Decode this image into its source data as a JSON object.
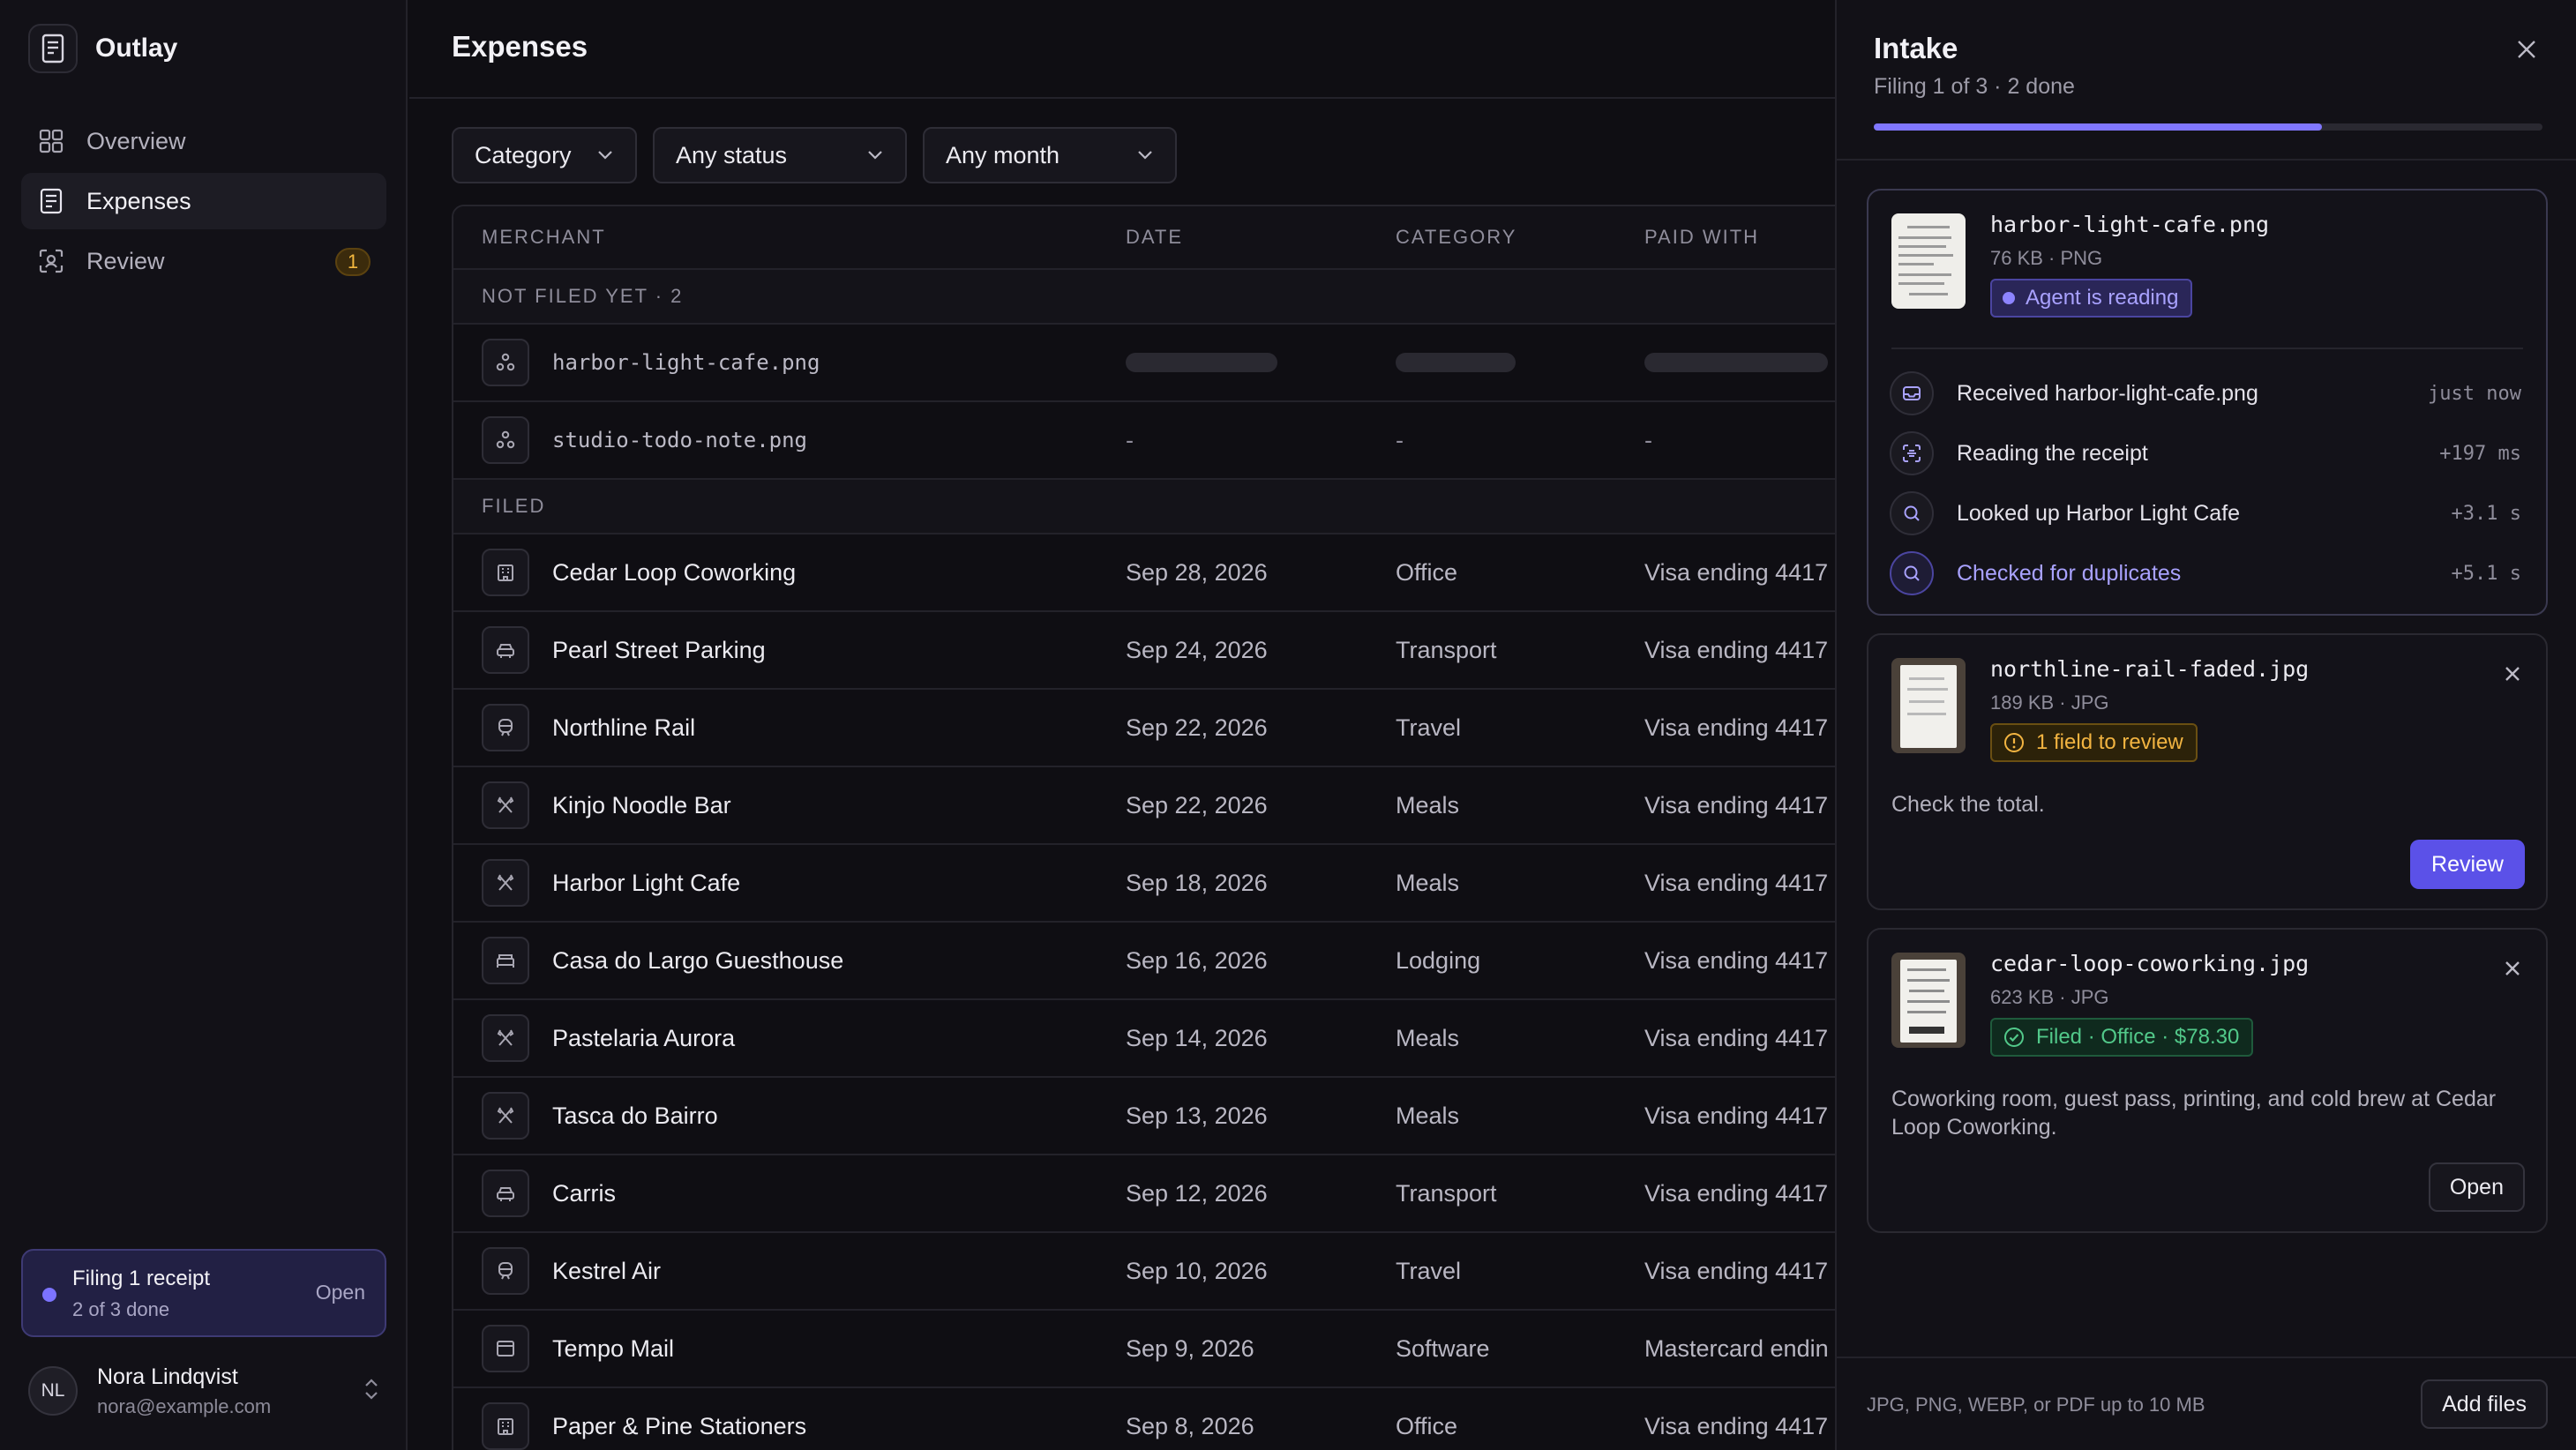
{
  "app": {
    "name": "Outlay"
  },
  "sidebar": {
    "items": [
      {
        "label": "Overview",
        "icon": "grid-icon"
      },
      {
        "label": "Expenses",
        "icon": "receipt-icon"
      },
      {
        "label": "Review",
        "icon": "scan-icon",
        "badge": "1"
      }
    ],
    "filing": {
      "title": "Filing 1 receipt",
      "subtitle": "2 of 3 done",
      "action": "Open"
    },
    "user": {
      "initials": "NL",
      "name": "Nora Lindqvist",
      "email": "nora@example.com"
    }
  },
  "main": {
    "title": "Expenses",
    "filters": {
      "category": "Category",
      "status": "Any status",
      "month": "Any month"
    },
    "columns": {
      "merchant": "MERCHANT",
      "date": "DATE",
      "category": "CATEGORY",
      "paid_with": "PAID WITH"
    },
    "groups": {
      "not_filed": "NOT FILED YET · 2",
      "filed": "FILED"
    },
    "pending": [
      {
        "file": "harbor-light-cafe.png",
        "state": "loading"
      },
      {
        "file": "studio-todo-note.png",
        "date": "-",
        "category": "-",
        "paid_with": "-"
      }
    ],
    "rows": [
      {
        "merchant": "Cedar Loop Coworking",
        "date": "Sep 28, 2026",
        "category": "Office",
        "paid_with": "Visa ending 4417",
        "icon": "building-icon"
      },
      {
        "merchant": "Pearl Street Parking",
        "date": "Sep 24, 2026",
        "category": "Transport",
        "paid_with": "Visa ending 4417",
        "icon": "car-icon"
      },
      {
        "merchant": "Northline Rail",
        "date": "Sep 22, 2026",
        "category": "Travel",
        "paid_with": "Visa ending 4417",
        "icon": "train-icon"
      },
      {
        "merchant": "Kinjo Noodle Bar",
        "date": "Sep 22, 2026",
        "category": "Meals",
        "paid_with": "Visa ending 4417",
        "icon": "utensils-icon"
      },
      {
        "merchant": "Harbor Light Cafe",
        "date": "Sep 18, 2026",
        "category": "Meals",
        "paid_with": "Visa ending 4417",
        "icon": "utensils-icon"
      },
      {
        "merchant": "Casa do Largo Guesthouse",
        "date": "Sep 16, 2026",
        "category": "Lodging",
        "paid_with": "Visa ending 4417",
        "icon": "bed-icon"
      },
      {
        "merchant": "Pastelaria Aurora",
        "date": "Sep 14, 2026",
        "category": "Meals",
        "paid_with": "Visa ending 4417",
        "icon": "utensils-icon"
      },
      {
        "merchant": "Tasca do Bairro",
        "date": "Sep 13, 2026",
        "category": "Meals",
        "paid_with": "Visa ending 4417",
        "icon": "utensils-icon"
      },
      {
        "merchant": "Carris",
        "date": "Sep 12, 2026",
        "category": "Transport",
        "paid_with": "Visa ending 4417",
        "icon": "car-icon"
      },
      {
        "merchant": "Kestrel Air",
        "date": "Sep 10, 2026",
        "category": "Travel",
        "paid_with": "Visa ending 4417",
        "icon": "train-icon"
      },
      {
        "merchant": "Tempo Mail",
        "date": "Sep 9, 2026",
        "category": "Software",
        "paid_with": "Mastercard endin",
        "icon": "window-icon"
      },
      {
        "merchant": "Paper & Pine Stationers",
        "date": "Sep 8, 2026",
        "category": "Office",
        "paid_with": "Visa ending 4417",
        "icon": "building-icon"
      }
    ]
  },
  "intake": {
    "title": "Intake",
    "subtitle": "Filing 1 of 3 · 2 done",
    "progress": 0.67,
    "cards": [
      {
        "file": "harbor-light-cafe.png",
        "meta": "76 KB · PNG",
        "status": "Agent is reading",
        "steps": [
          {
            "label": "Received harbor-light-cafe.png",
            "time": "just now",
            "icon": "inbox-icon"
          },
          {
            "label": "Reading the receipt",
            "time": "+197 ms",
            "icon": "scan-icon"
          },
          {
            "label": "Looked up Harbor Light Cafe",
            "time": "+3.1 s",
            "icon": "search-icon"
          },
          {
            "label": "Checked for duplicates",
            "time": "+5.1 s",
            "icon": "search-icon"
          }
        ]
      },
      {
        "file": "northline-rail-faded.jpg",
        "meta": "189 KB · JPG",
        "status": "1 field to review",
        "note": "Check the total.",
        "action": "Review"
      },
      {
        "file": "cedar-loop-coworking.jpg",
        "meta": "623 KB · JPG",
        "status": "Filed · Office · $78.30",
        "note": "Coworking room, guest pass, printing, and cold brew at Cedar Loop Coworking.",
        "action": "Open"
      }
    ],
    "footer": {
      "hint": "JPG, PNG, WEBP, or PDF up to 10 MB",
      "action": "Add files"
    }
  },
  "colors": {
    "accent": "#5b51e8",
    "warning": "#f2b441",
    "success": "#52c98a",
    "background": "#0f0e13"
  }
}
